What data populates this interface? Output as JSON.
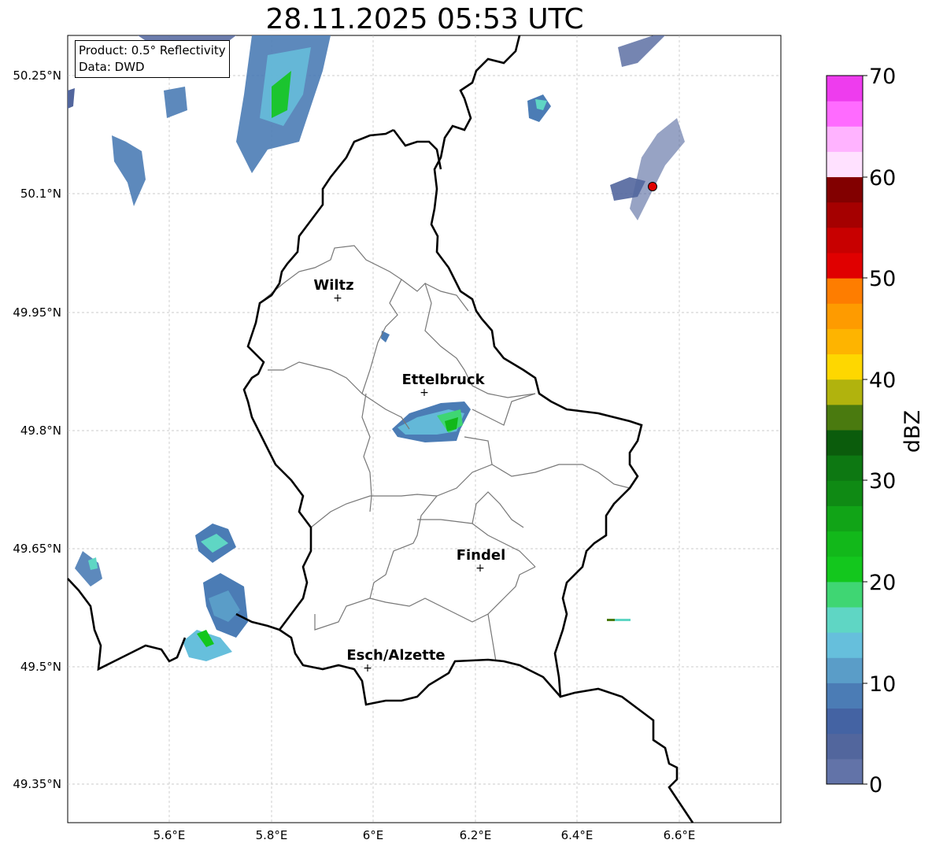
{
  "title": "28.11.2025 05:53 UTC",
  "info": {
    "product": "Product: 0.5° Reflectivity",
    "data": "Data: DWD"
  },
  "lat_ticks": [
    "50.25°N",
    "50.1°N",
    "49.95°N",
    "49.8°N",
    "49.65°N",
    "49.5°N",
    "49.35°N"
  ],
  "lon_ticks": [
    "5.6°E",
    "5.8°E",
    "6°E",
    "6.2°E",
    "6.4°E",
    "6.6°E"
  ],
  "cities": [
    {
      "name": "Wiltz"
    },
    {
      "name": "Ettelbruck"
    },
    {
      "name": "Findel"
    },
    {
      "name": "Esch/Alzette"
    }
  ],
  "colorbar": {
    "label": "dBZ",
    "ticks": [
      "0",
      "10",
      "20",
      "30",
      "40",
      "50",
      "60",
      "70"
    ],
    "colors": [
      "#6273a8",
      "#52669d",
      "#4463a3",
      "#4b7cb5",
      "#5a9dc8",
      "#66bfdc",
      "#5fd6c4",
      "#3fd673",
      "#13c71d",
      "#12b81a",
      "#11a417",
      "#0f8a14",
      "#0d7812",
      "#0b5c0c",
      "#4a7a0f",
      "#b1b30d",
      "#fed700",
      "#feb400",
      "#fe9b00",
      "#fe7d00",
      "#e00000",
      "#c80000",
      "#a50000",
      "#820000",
      "#ffe1ff",
      "#ffb3ff",
      "#ff6bff",
      "#ee3cee"
    ]
  },
  "map": {
    "lon_range": [
      5.4,
      6.8
    ],
    "lat_range": [
      49.3,
      50.3
    ],
    "radar_site": {
      "color": "#e00000"
    }
  }
}
